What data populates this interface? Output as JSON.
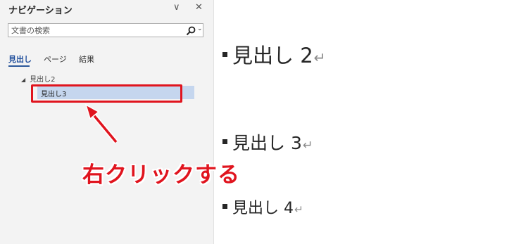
{
  "nav": {
    "title": "ナビゲーション",
    "chevron_glyph": "∨",
    "close_glyph": "✕",
    "search_placeholder": "文書の検索",
    "search_caret": "⌄",
    "tabs": [
      {
        "label": "見出し",
        "active": true
      },
      {
        "label": "ページ",
        "active": false
      },
      {
        "label": "結果",
        "active": false
      }
    ],
    "tree": [
      {
        "label": "見出し2",
        "expanded": true,
        "level": 1
      },
      {
        "label": "見出し3",
        "selected": true,
        "level": 2
      }
    ]
  },
  "annotation": {
    "callout_text": "右クリックする",
    "color": "#e0141e"
  },
  "document": {
    "headings": [
      {
        "text": "見出し 2",
        "mark": "↵"
      },
      {
        "text": "見出し 3",
        "mark": "↵"
      },
      {
        "text": "見出し 4",
        "mark": "↵"
      }
    ]
  },
  "colors": {
    "pane_bg": "#f3f3f3",
    "selected_row": "#c5d6ee",
    "active_tab": "#2b579a"
  }
}
